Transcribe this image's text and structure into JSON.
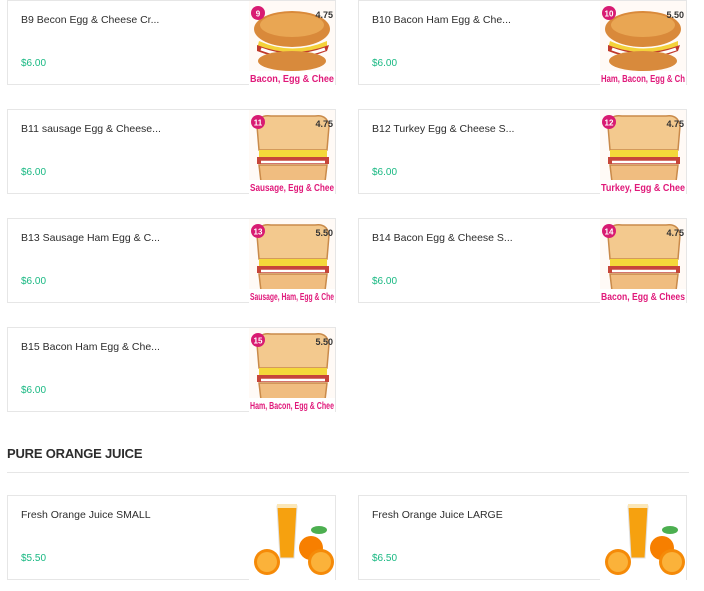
{
  "items": [
    {
      "name": "B9 Becon Egg & Cheese Cr...",
      "price": "$6.00",
      "num": "9",
      "cost": "4.75",
      "caption": "Bacon, Egg & Chee",
      "bread": "croissant"
    },
    {
      "name": "B10 Bacon Ham Egg & Che...",
      "price": "$6.00",
      "num": "10",
      "cost": "5.50",
      "caption": "Ham, Bacon, Egg & Ch",
      "bread": "croissant"
    },
    {
      "name": "B11 sausage Egg & Cheese...",
      "price": "$6.00",
      "num": "11",
      "cost": "4.75",
      "caption": "Sausage, Egg & Chee",
      "bread": "toast"
    },
    {
      "name": "B12 Turkey Egg & Cheese S...",
      "price": "$6.00",
      "num": "12",
      "cost": "4.75",
      "caption": "Turkey, Egg & Chee",
      "bread": "toast"
    },
    {
      "name": "B13 Sausage Ham Egg & C...",
      "price": "$6.00",
      "num": "13",
      "cost": "5.50",
      "caption": "Sausage, Ham, Egg & Che",
      "bread": "toast"
    },
    {
      "name": "B14 Bacon Egg & Cheese S...",
      "price": "$6.00",
      "num": "14",
      "cost": "4.75",
      "caption": "Bacon, Egg & Chees",
      "bread": "toast"
    },
    {
      "name": "B15 Bacon Ham Egg & Che...",
      "price": "$6.00",
      "num": "15",
      "cost": "5.50",
      "caption": "Ham, Bacon, Egg & Chee",
      "bread": "toast"
    }
  ],
  "section": {
    "title": "PURE ORANGE JUICE"
  },
  "juices": [
    {
      "name": "Fresh Orange Juice SMALL",
      "price": "$5.50"
    },
    {
      "name": "Fresh Orange Juice LARGE",
      "price": "$6.50"
    }
  ],
  "colors": {
    "price": "#18b882",
    "badge": "#d81b72",
    "caption": "#e0197a",
    "border": "#e6e6e6"
  }
}
